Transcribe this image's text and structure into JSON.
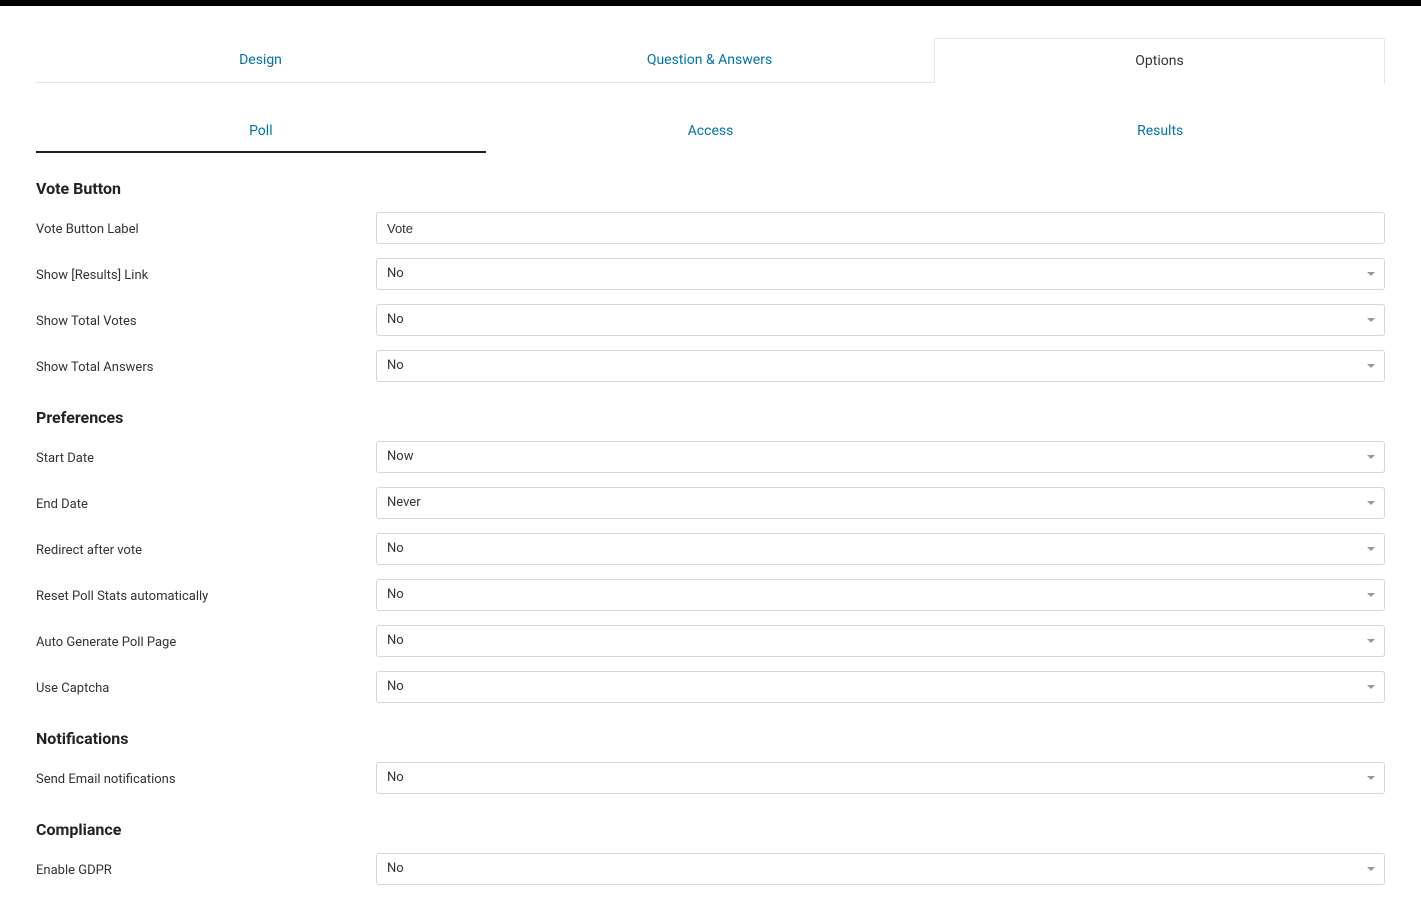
{
  "primaryTabs": {
    "design": "Design",
    "qa": "Question & Answers",
    "options": "Options"
  },
  "secondaryTabs": {
    "poll": "Poll",
    "access": "Access",
    "results": "Results"
  },
  "sections": {
    "voteButton": {
      "header": "Vote Button",
      "voteButtonLabel": {
        "label": "Vote Button Label",
        "value": "Vote"
      },
      "showResultsLink": {
        "label": "Show [Results] Link",
        "value": "No"
      },
      "showTotalVotes": {
        "label": "Show Total Votes",
        "value": "No"
      },
      "showTotalAnswers": {
        "label": "Show Total Answers",
        "value": "No"
      }
    },
    "preferences": {
      "header": "Preferences",
      "startDate": {
        "label": "Start Date",
        "value": "Now"
      },
      "endDate": {
        "label": "End Date",
        "value": "Never"
      },
      "redirectAfterVote": {
        "label": "Redirect after vote",
        "value": "No"
      },
      "resetPollStats": {
        "label": "Reset Poll Stats automatically",
        "value": "No"
      },
      "autoGeneratePollPage": {
        "label": "Auto Generate Poll Page",
        "value": "No"
      },
      "useCaptcha": {
        "label": "Use Captcha",
        "value": "No"
      }
    },
    "notifications": {
      "header": "Notifications",
      "sendEmail": {
        "label": "Send Email notifications",
        "value": "No"
      }
    },
    "compliance": {
      "header": "Compliance",
      "enableGdpr": {
        "label": "Enable GDPR",
        "value": "No"
      }
    }
  }
}
